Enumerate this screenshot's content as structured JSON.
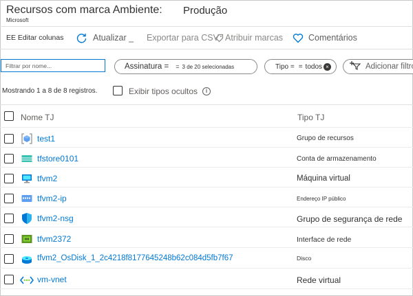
{
  "header": {
    "title": "Recursos com marca Ambiente:",
    "subtitle": "Microsoft",
    "environment": "Produção"
  },
  "toolbar": {
    "edit_columns": "EE Editar colunas",
    "refresh": "Atualizar _",
    "export_csv": "Exportar para CSV",
    "assign_tags": "Atribuir marcas",
    "feedback": "Comentários"
  },
  "filters": {
    "search_placeholder": "Filtrar por nome...",
    "subscription_label": "Assinatura =",
    "subscription_value": "3 de 20 selecionadas",
    "type_label": "Tipo =",
    "type_value": "todos",
    "add_filter": "Adicionar filtro"
  },
  "status": {
    "records_text": "Mostrando 1 a 8 de 8 registros.",
    "show_hidden_label": "Exibir tipos ocultos"
  },
  "table": {
    "headers": {
      "name": "Nome TJ",
      "type": "Tipo TJ"
    },
    "rows": [
      {
        "name": "test1",
        "type": "Grupo de recursos",
        "icon": "resource-group-icon"
      },
      {
        "name": "tfstore0101",
        "type": "Conta de armazenamento",
        "icon": "storage-account-icon"
      },
      {
        "name": "tfvm2",
        "type": "Máquina virtual",
        "icon": "virtual-machine-icon"
      },
      {
        "name": "tfvm2-ip",
        "type": "Endereço IP público",
        "icon": "public-ip-icon"
      },
      {
        "name": "tfvm2-nsg",
        "type": "Grupo de segurança de rede",
        "icon": "nsg-shield-icon"
      },
      {
        "name": "tfvm2372",
        "type": "Interface de rede",
        "icon": "network-interface-icon"
      },
      {
        "name": "tfvm2_OsDisk_1_2c4218f8177645248b62c084d5fb7f67",
        "type": "Disco",
        "icon": "disk-icon"
      },
      {
        "name": "vm-vnet",
        "type": "Rede virtual",
        "icon": "vnet-icon"
      }
    ]
  },
  "colors": {
    "link": "#0078d4",
    "text": "#323130",
    "muted": "#605e5c",
    "border": "#8a8886"
  }
}
